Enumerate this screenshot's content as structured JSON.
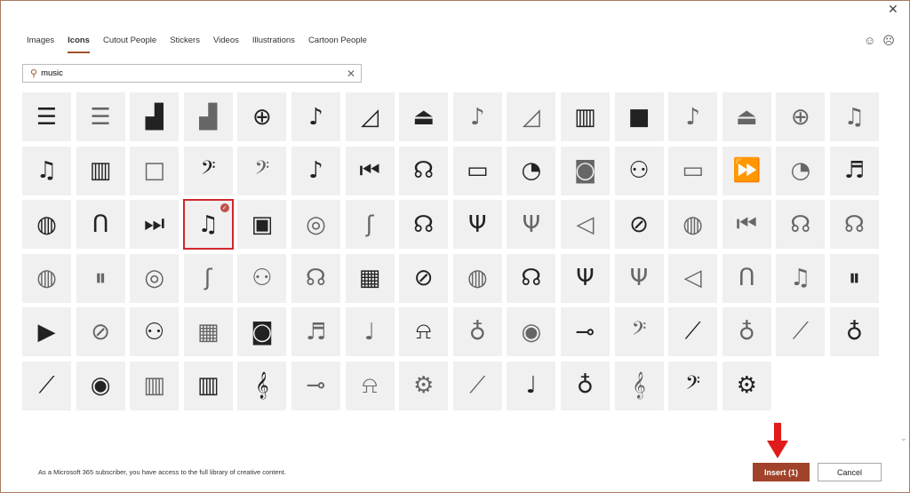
{
  "tabs": [
    "Images",
    "Icons",
    "Cutout People",
    "Stickers",
    "Videos",
    "Illustrations",
    "Cartoon People"
  ],
  "active_tab": "Icons",
  "search": {
    "value": "music"
  },
  "icons": [
    "xylophone",
    "xylophone-outline",
    "grand-piano",
    "grand-piano-outline",
    "gong",
    "acoustic-guitar",
    "harp",
    "eject",
    "acoustic-guitar-outline",
    "harp-outline",
    "equalizer",
    "stop",
    "music-note-outline",
    "eject-outline",
    "gong-outline",
    "music-notes-outline",
    "music-notes",
    "equalizer-bars",
    "stop-outline",
    "violin",
    "violin-outline",
    "music-note",
    "rewind",
    "headphones-user-cd",
    "dvd-player",
    "gramophone",
    "turntable-outline",
    "dancing-people",
    "dvd-player-outline",
    "fast-forward-outline",
    "gramophone-outline",
    "music-staff",
    "drum",
    "earbuds",
    "next-track",
    "music-notes",
    "radio",
    "vinyl-outline",
    "saxophone-outline",
    "headphones-user",
    "tuning-fork",
    "tuning-fork-outline",
    "speaker-volume-outline",
    "banjo",
    "drum-outline",
    "previous-track-outline",
    "headphones-user-outline",
    "headphones-user-outline",
    "bass-drum-outline",
    "pause-outline",
    "vinyl-outline",
    "saxophone-outline",
    "dancer-outline",
    "headphones-outline",
    "speakers",
    "banjo",
    "drum-outline",
    "headphones-user-cd",
    "tuning-fork",
    "tuning-fork-outline",
    "speaker-volume-outline",
    "earbuds-outline",
    "music-notes-outline",
    "pause",
    "play",
    "banjo-outline",
    "dancer",
    "speakers-outline",
    "turntable",
    "music-staff-outline",
    "electric-guitar-outline",
    "bells",
    "microphone-outline",
    "cd-outline",
    "trumpet",
    "bass-clef-outline",
    "clarinet",
    "microphone-stand-outline",
    "flute-outline",
    "microphone",
    "clarinet",
    "cd",
    "piano-keys-outline",
    "piano-keys",
    "treble-clef",
    "trumpet-outline",
    "bells-outline",
    "drum-kit-outline",
    "clarinet-outline",
    "electric-guitar",
    "microphone",
    "treble-clef-outline",
    "bass-clef",
    "drum-kit"
  ],
  "selected_index": 35,
  "footer_text": "As a Microsoft 365 subscriber, you have access to the full library of creative content.",
  "insert_label": "Insert (1)",
  "cancel_label": "Cancel",
  "colors": {
    "accent": "#a0432a",
    "selection": "#d0282c",
    "arrow": "#e01b1b"
  }
}
